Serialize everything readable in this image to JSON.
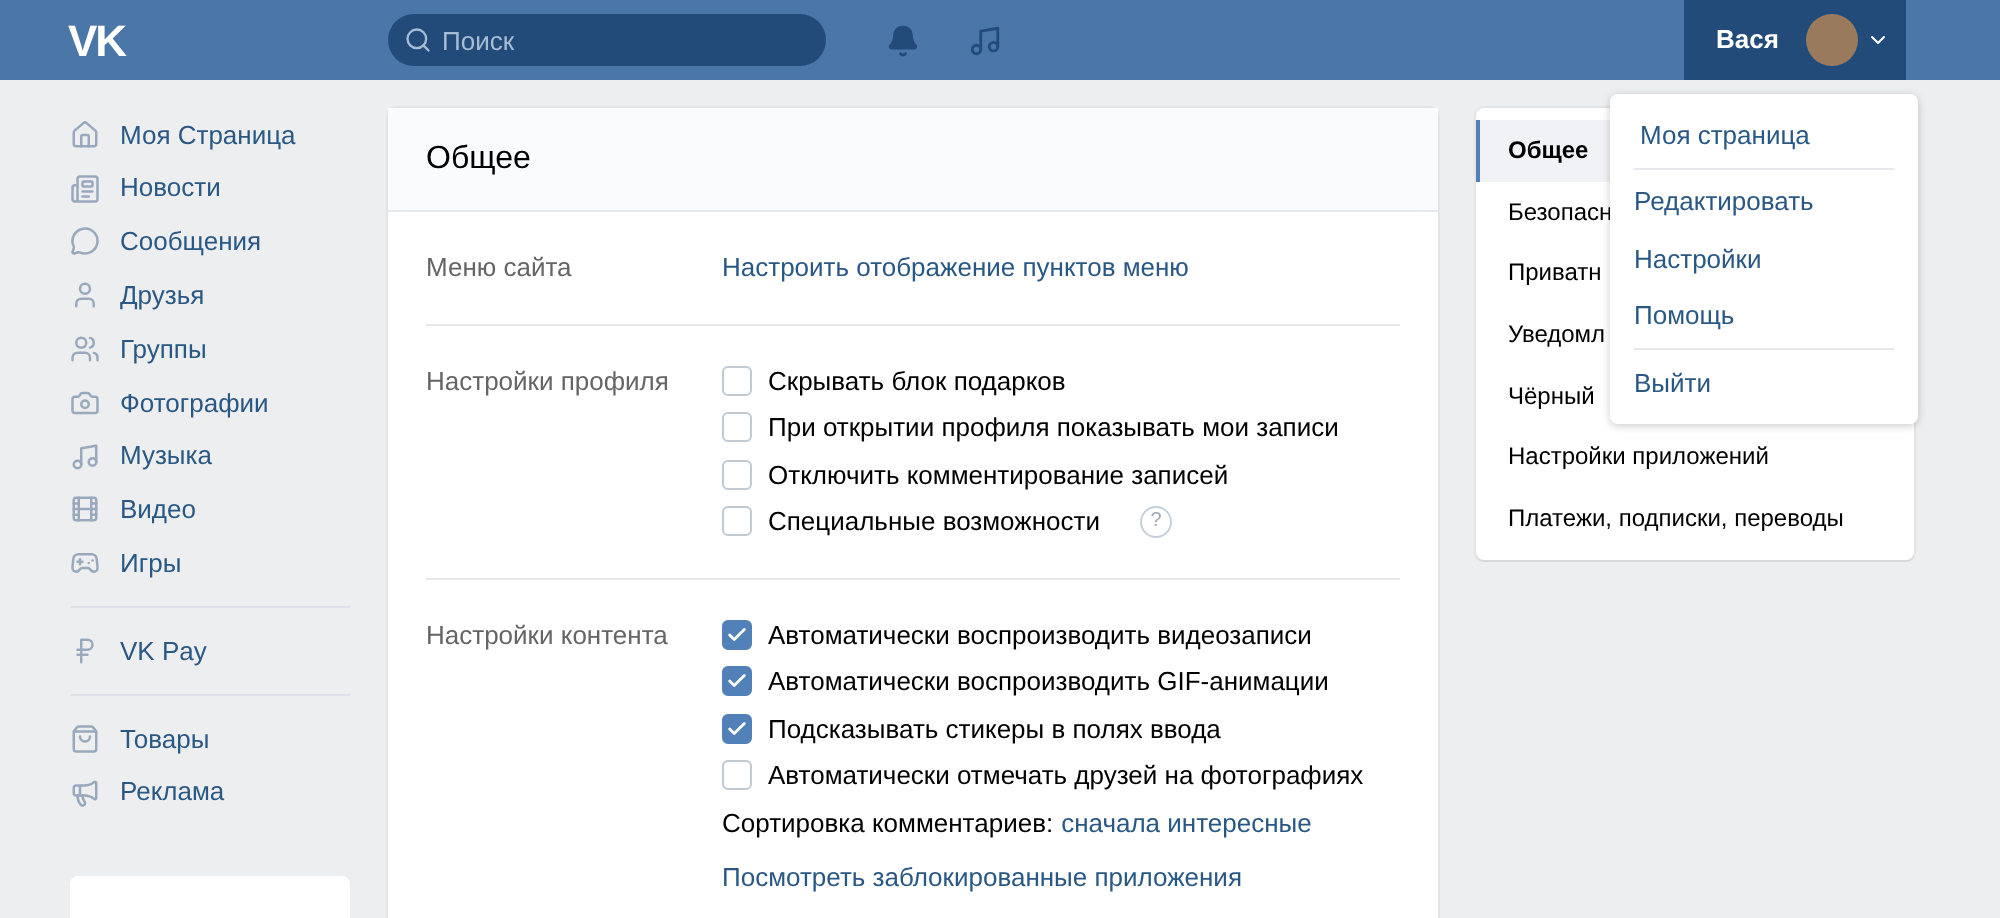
{
  "header": {
    "logo": "VK",
    "search": {
      "placeholder": "Поиск"
    },
    "user": {
      "name": "Вася"
    }
  },
  "sidebar": {
    "groups": [
      [
        {
          "label": "Моя Страница"
        },
        {
          "label": "Новости"
        },
        {
          "label": "Сообщения"
        },
        {
          "label": "Друзья"
        },
        {
          "label": "Группы"
        },
        {
          "label": "Фотографии"
        },
        {
          "label": "Музыка"
        },
        {
          "label": "Видео"
        },
        {
          "label": "Игры"
        }
      ],
      [
        {
          "label": "VK Pay"
        }
      ],
      [
        {
          "label": "Товары"
        },
        {
          "label": "Реклама"
        }
      ]
    ]
  },
  "settings": {
    "title": "Общее",
    "sections": [
      {
        "label": "Меню сайта",
        "items": [
          {
            "kind": "link",
            "text": "Настроить отображение пунктов меню"
          }
        ]
      },
      {
        "label": "Настройки профиля",
        "items": [
          {
            "kind": "checkbox",
            "text": "Скрывать блок подарков",
            "checked": false
          },
          {
            "kind": "checkbox",
            "text": "При открытии профиля показывать мои записи",
            "checked": false
          },
          {
            "kind": "checkbox",
            "text": "Отключить комментирование записей",
            "checked": false
          },
          {
            "kind": "checkbox",
            "text": "Специальные возможности",
            "checked": false,
            "help": "?"
          }
        ]
      },
      {
        "label": "Настройки контента",
        "items": [
          {
            "kind": "checkbox",
            "text": "Автоматически воспроизводить видеозаписи",
            "checked": true
          },
          {
            "kind": "checkbox",
            "text": "Автоматически воспроизводить GIF-анимации",
            "checked": true
          },
          {
            "kind": "checkbox",
            "text": "Подсказывать стикеры в полях ввода",
            "checked": true
          },
          {
            "kind": "checkbox",
            "text": "Автоматически отмечать друзей на фотографиях",
            "checked": false
          },
          {
            "kind": "choice",
            "text": "Сортировка комментариев:",
            "value": "сначала интересные"
          },
          {
            "kind": "link",
            "text": "Посмотреть заблокированные приложения"
          }
        ]
      }
    ]
  },
  "settings_nav": [
    {
      "label": "Общее",
      "selected": true
    },
    {
      "label": "Безопасн",
      "selected": false
    },
    {
      "label": "Приватн",
      "selected": false
    },
    {
      "label": "Уведомл",
      "selected": false
    },
    {
      "label": "Чёрный",
      "selected": false
    },
    {
      "label": "Настройки приложений",
      "selected": false
    },
    {
      "label": "Платежи, подписки, переводы",
      "selected": false
    }
  ],
  "user_menu": {
    "groups": [
      [
        "Моя страница"
      ],
      [
        "Редактировать",
        "Настройки",
        "Помощь"
      ],
      [
        "Выйти"
      ]
    ]
  }
}
